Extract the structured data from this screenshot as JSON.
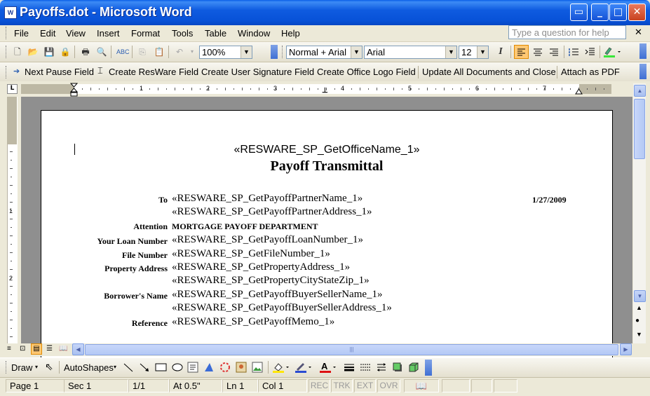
{
  "window": {
    "title": "Payoffs.dot - Microsoft Word",
    "app_icon": "W"
  },
  "menu": [
    "File",
    "Edit",
    "View",
    "Insert",
    "Format",
    "Tools",
    "Table",
    "Window",
    "Help"
  ],
  "help_box": {
    "placeholder": "Type a question for help"
  },
  "standard_toolbar": {
    "zoom": "100%",
    "style": "Normal + Arial",
    "font": "Arial",
    "size": "12"
  },
  "resware_toolbar": {
    "items": [
      "Next Pause Field",
      "Create ResWare Field",
      "Create User Signature Field",
      "Create Office Logo Field",
      "Update All Documents and Close",
      "Attach as PDF"
    ]
  },
  "ruler": {
    "numbers": [
      "1",
      "2",
      "3",
      "4",
      "5",
      "6",
      "7"
    ],
    "vnumbers": [
      "1",
      "2"
    ]
  },
  "document": {
    "office_name": "«RESWARE_SP_GetOfficeName_1»",
    "heading": "Payoff Transmittal",
    "date": "1/27/2009",
    "rows": [
      {
        "label": "To",
        "value": "«RESWARE_SP_GetPayoffPartnerName_1»"
      },
      {
        "label": "",
        "value": "«RESWARE_SP_GetPayoffPartnerAddress_1»"
      },
      {
        "label": "Attention",
        "value": "MORTGAGE PAYOFF DEPARTMENT"
      },
      {
        "label": "Your Loan Number",
        "value": "«RESWARE_SP_GetPayoffLoanNumber_1»"
      },
      {
        "label": "File Number",
        "value": "«RESWARE_SP_GetFileNumber_1»"
      },
      {
        "label": "Property Address",
        "value": "«RESWARE_SP_GetPropertyAddress_1»"
      },
      {
        "label": "",
        "value": "«RESWARE_SP_GetPropertyCityStateZip_1»"
      },
      {
        "label": "Borrower's Name",
        "value": "«RESWARE_SP_GetPayoffBuyerSellerName_1»"
      },
      {
        "label": "",
        "value": "«RESWARE_SP_GetPayoffBuyerSellerAddress_1»"
      },
      {
        "label": "Reference",
        "value": "«RESWARE_SP_GetPayoffMemo_1»"
      }
    ]
  },
  "drawing_toolbar": {
    "draw": "Draw",
    "autoshapes": "AutoShapes"
  },
  "status": {
    "page": "Page 1",
    "sec": "Sec 1",
    "pages": "1/1",
    "at": "At 0.5\"",
    "ln": "Ln 1",
    "col": "Col 1",
    "rec": "REC",
    "trk": "TRK",
    "ext": "EXT",
    "ovr": "OVR"
  }
}
